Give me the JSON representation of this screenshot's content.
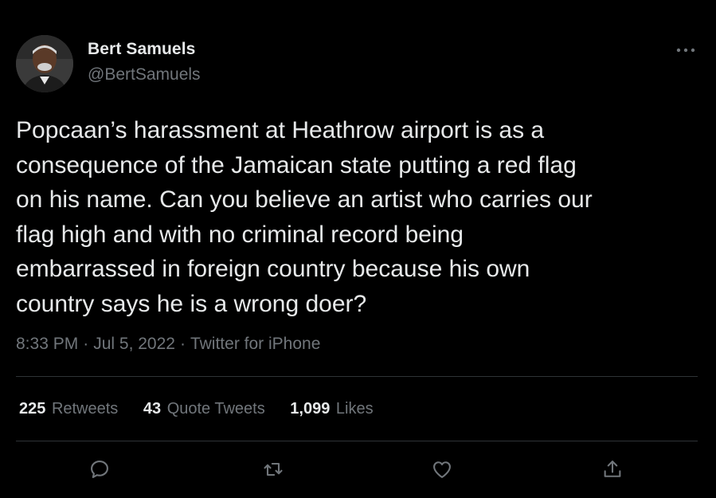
{
  "author": {
    "name": "Bert Samuels",
    "handle": "@BertSamuels",
    "avatar_icon": "user-avatar"
  },
  "more_icon": "ellipsis-icon",
  "tweet": {
    "text": "Popcaan’s harassment at Heathrow airport is as a\nconsequence of the Jamaican state putting a red flag\non his name. Can you believe an artist who carries our\nflag high and with no criminal record being\nembarrassed in foreign country because his own\ncountry says he is a wrong doer?",
    "time": "8:33 PM",
    "date": "Jul 5, 2022",
    "source": "Twitter for iPhone",
    "separator": "·"
  },
  "stats": {
    "retweets": {
      "count": "225",
      "label": "Retweets"
    },
    "quote_tweets": {
      "count": "43",
      "label": "Quote Tweets"
    },
    "likes": {
      "count": "1,099",
      "label": "Likes"
    }
  },
  "actions": [
    "reply-icon",
    "retweet-icon",
    "like-icon",
    "share-icon"
  ],
  "colors": {
    "background": "#000000",
    "primary_text": "#e7e9ea",
    "secondary_text": "#71767b",
    "divider": "#2f3336"
  }
}
